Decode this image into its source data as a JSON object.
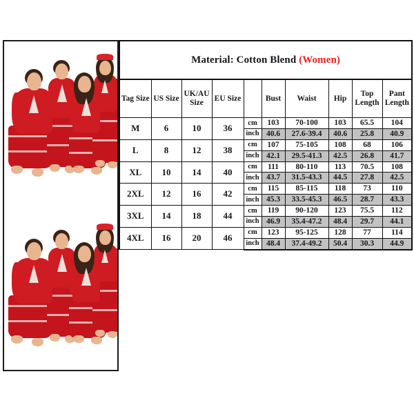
{
  "title": {
    "main": "Material: Cotton Blend",
    "accent": "(Women)"
  },
  "photos": [
    {
      "name": "family-matching-red-christmas-pajamas-photo-1",
      "alt": "Family of four wearing matching red Christmas tree pajamas"
    },
    {
      "name": "family-matching-red-christmas-pajamas-photo-2",
      "alt": "Family of four wearing matching red Christmas tree pajamas"
    }
  ],
  "table": {
    "headers": {
      "tag_size": "Tag Size",
      "us_size": "US Size",
      "uk_au_size": "UK/AU Size",
      "eu_size": "EU Size",
      "unit": "",
      "bust": "Bust",
      "waist": "Waist",
      "hip": "Hip",
      "top_length": "Top Length",
      "pant_length": "Pant Length"
    },
    "unit_labels": {
      "cm": "cm",
      "inch": "inch"
    },
    "rows": [
      {
        "tag_size": "M",
        "us_size": "6",
        "uk_au_size": "10",
        "eu_size": "36",
        "cm": {
          "bust": "103",
          "waist": "70-100",
          "hip": "103",
          "top_length": "65.5",
          "pant_length": "104"
        },
        "inch": {
          "bust": "40.6",
          "waist": "27.6-39.4",
          "hip": "40.6",
          "top_length": "25.8",
          "pant_length": "40.9"
        }
      },
      {
        "tag_size": "L",
        "us_size": "8",
        "uk_au_size": "12",
        "eu_size": "38",
        "cm": {
          "bust": "107",
          "waist": "75-105",
          "hip": "108",
          "top_length": "68",
          "pant_length": "106"
        },
        "inch": {
          "bust": "42.1",
          "waist": "29.5-41.3",
          "hip": "42.5",
          "top_length": "26.8",
          "pant_length": "41.7"
        }
      },
      {
        "tag_size": "XL",
        "us_size": "10",
        "uk_au_size": "14",
        "eu_size": "40",
        "cm": {
          "bust": "111",
          "waist": "80-110",
          "hip": "113",
          "top_length": "70.5",
          "pant_length": "108"
        },
        "inch": {
          "bust": "43.7",
          "waist": "31.5-43.3",
          "hip": "44.5",
          "top_length": "27.8",
          "pant_length": "42.5"
        }
      },
      {
        "tag_size": "2XL",
        "us_size": "12",
        "uk_au_size": "16",
        "eu_size": "42",
        "cm": {
          "bust": "115",
          "waist": "85-115",
          "hip": "118",
          "top_length": "73",
          "pant_length": "110"
        },
        "inch": {
          "bust": "45.3",
          "waist": "33.5-45.3",
          "hip": "46.5",
          "top_length": "28.7",
          "pant_length": "43.3"
        }
      },
      {
        "tag_size": "3XL",
        "us_size": "14",
        "uk_au_size": "18",
        "eu_size": "44",
        "cm": {
          "bust": "119",
          "waist": "90-120",
          "hip": "123",
          "top_length": "75.5",
          "pant_length": "112"
        },
        "inch": {
          "bust": "46.9",
          "waist": "35.4-47.2",
          "hip": "48.4",
          "top_length": "29.7",
          "pant_length": "44.1"
        }
      },
      {
        "tag_size": "4XL",
        "us_size": "16",
        "uk_au_size": "20",
        "eu_size": "46",
        "cm": {
          "bust": "123",
          "waist": "95-125",
          "hip": "128",
          "top_length": "77",
          "pant_length": "114"
        },
        "inch": {
          "bust": "48.4",
          "waist": "37.4-49.2",
          "hip": "50.4",
          "top_length": "30.3",
          "pant_length": "44.9"
        }
      }
    ]
  },
  "colors": {
    "accent_red": "#ee1f1a",
    "shaded_row": "#c2c2c2",
    "border": "#111111",
    "text": "#16161b",
    "garment_red": "#cf1b22"
  }
}
